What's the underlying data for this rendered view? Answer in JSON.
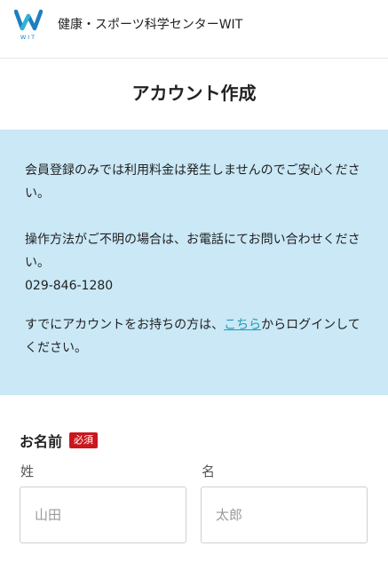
{
  "header": {
    "logo_text": "WIT",
    "site_name": "健康・スポーツ科学センターWIT"
  },
  "page": {
    "title": "アカウント作成"
  },
  "notice": {
    "paragraph1": "会員登録のみでは利用料金は発生しませんのでご安心ください。",
    "paragraph2": "操作方法がご不明の場合は、お電話にてお問い合わせください。",
    "phone": "029-846-1280",
    "login_prefix": "すでにアカウントをお持ちの方は、",
    "login_link": "こちら",
    "login_suffix": "からログインしてください。"
  },
  "form": {
    "name_label": "お名前",
    "required_badge": "必須",
    "last_name_label": "姓",
    "last_name_placeholder": "山田",
    "first_name_label": "名",
    "first_name_placeholder": "太郎"
  },
  "colors": {
    "brand_blue": "#1e7fbf",
    "notice_bg": "#cae8f6",
    "link": "#1f9bb3",
    "required": "#c9171e"
  }
}
